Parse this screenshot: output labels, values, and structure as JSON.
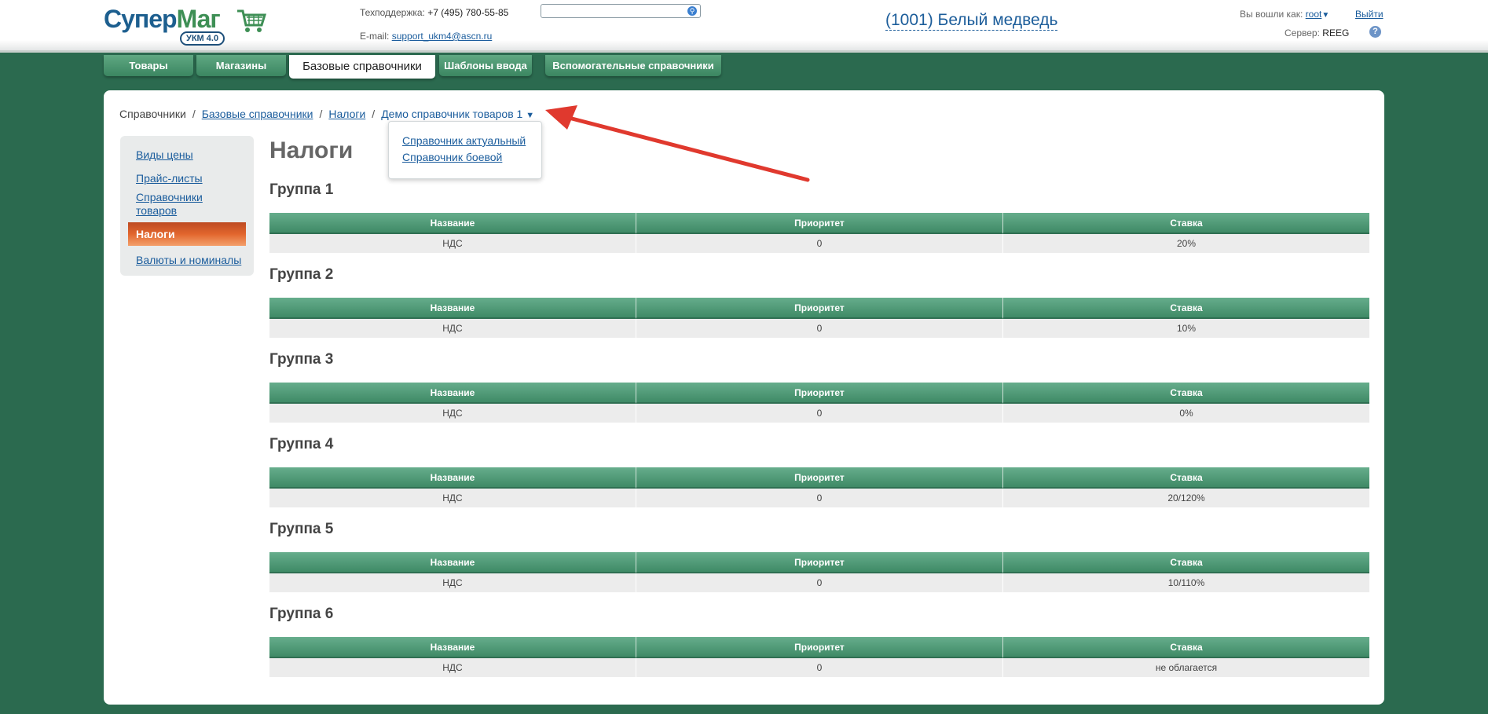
{
  "header": {
    "logo": {
      "name_part1": "Супер",
      "name_part2": "Маг",
      "badge": "УКМ 4.0"
    },
    "support_label": "Техподдержка:",
    "support_phone": "+7 (495) 780-55-85",
    "email_label": "E-mail:",
    "email": "support_ukm4@ascn.ru",
    "search": {
      "value": "",
      "placeholder": ""
    },
    "store": "(1001) Белый медведь",
    "logged_in_label": "Вы вошли как:",
    "user": "root",
    "logout": "Выйти",
    "server_label": "Сервер:",
    "server": "REEG",
    "help": "?"
  },
  "tabs": [
    {
      "label": "Товары"
    },
    {
      "label": "Магазины"
    },
    {
      "label": "Базовые справочники",
      "active": true
    },
    {
      "label": "Шаблоны ввода"
    },
    {
      "label": "Вспомогательные справочники"
    }
  ],
  "breadcrumb": {
    "root": "Справочники",
    "level1": "Базовые справочники",
    "level2": "Налоги",
    "current": "Демо справочник товаров 1"
  },
  "dropdown": [
    "Справочник актуальный",
    "Справочник боевой"
  ],
  "sidebar": [
    {
      "label": "Виды цены"
    },
    {
      "label": "Прайс-листы"
    },
    {
      "label": "Справочники товаров"
    },
    {
      "label": "Налоги",
      "active": true
    },
    {
      "label": "Валюты и номиналы"
    }
  ],
  "page_title": "Налоги",
  "table_headers": [
    "Название",
    "Приоритет",
    "Ставка"
  ],
  "groups": [
    {
      "title": "Группа 1",
      "row": [
        "НДС",
        "0",
        "20%"
      ]
    },
    {
      "title": "Группа 2",
      "row": [
        "НДС",
        "0",
        "10%"
      ]
    },
    {
      "title": "Группа 3",
      "row": [
        "НДС",
        "0",
        "0%"
      ]
    },
    {
      "title": "Группа 4",
      "row": [
        "НДС",
        "0",
        "20/120%"
      ]
    },
    {
      "title": "Группа 5",
      "row": [
        "НДС",
        "0",
        "10/110%"
      ]
    },
    {
      "title": "Группа 6",
      "row": [
        "НДС",
        "0",
        "не облагается"
      ]
    }
  ],
  "colors": {
    "background": "#2b6a4f",
    "header_green": "#4e9a76",
    "active_item": "#e2662d",
    "link": "#1a5c9c",
    "annotation_arrow": "#e0392e"
  }
}
